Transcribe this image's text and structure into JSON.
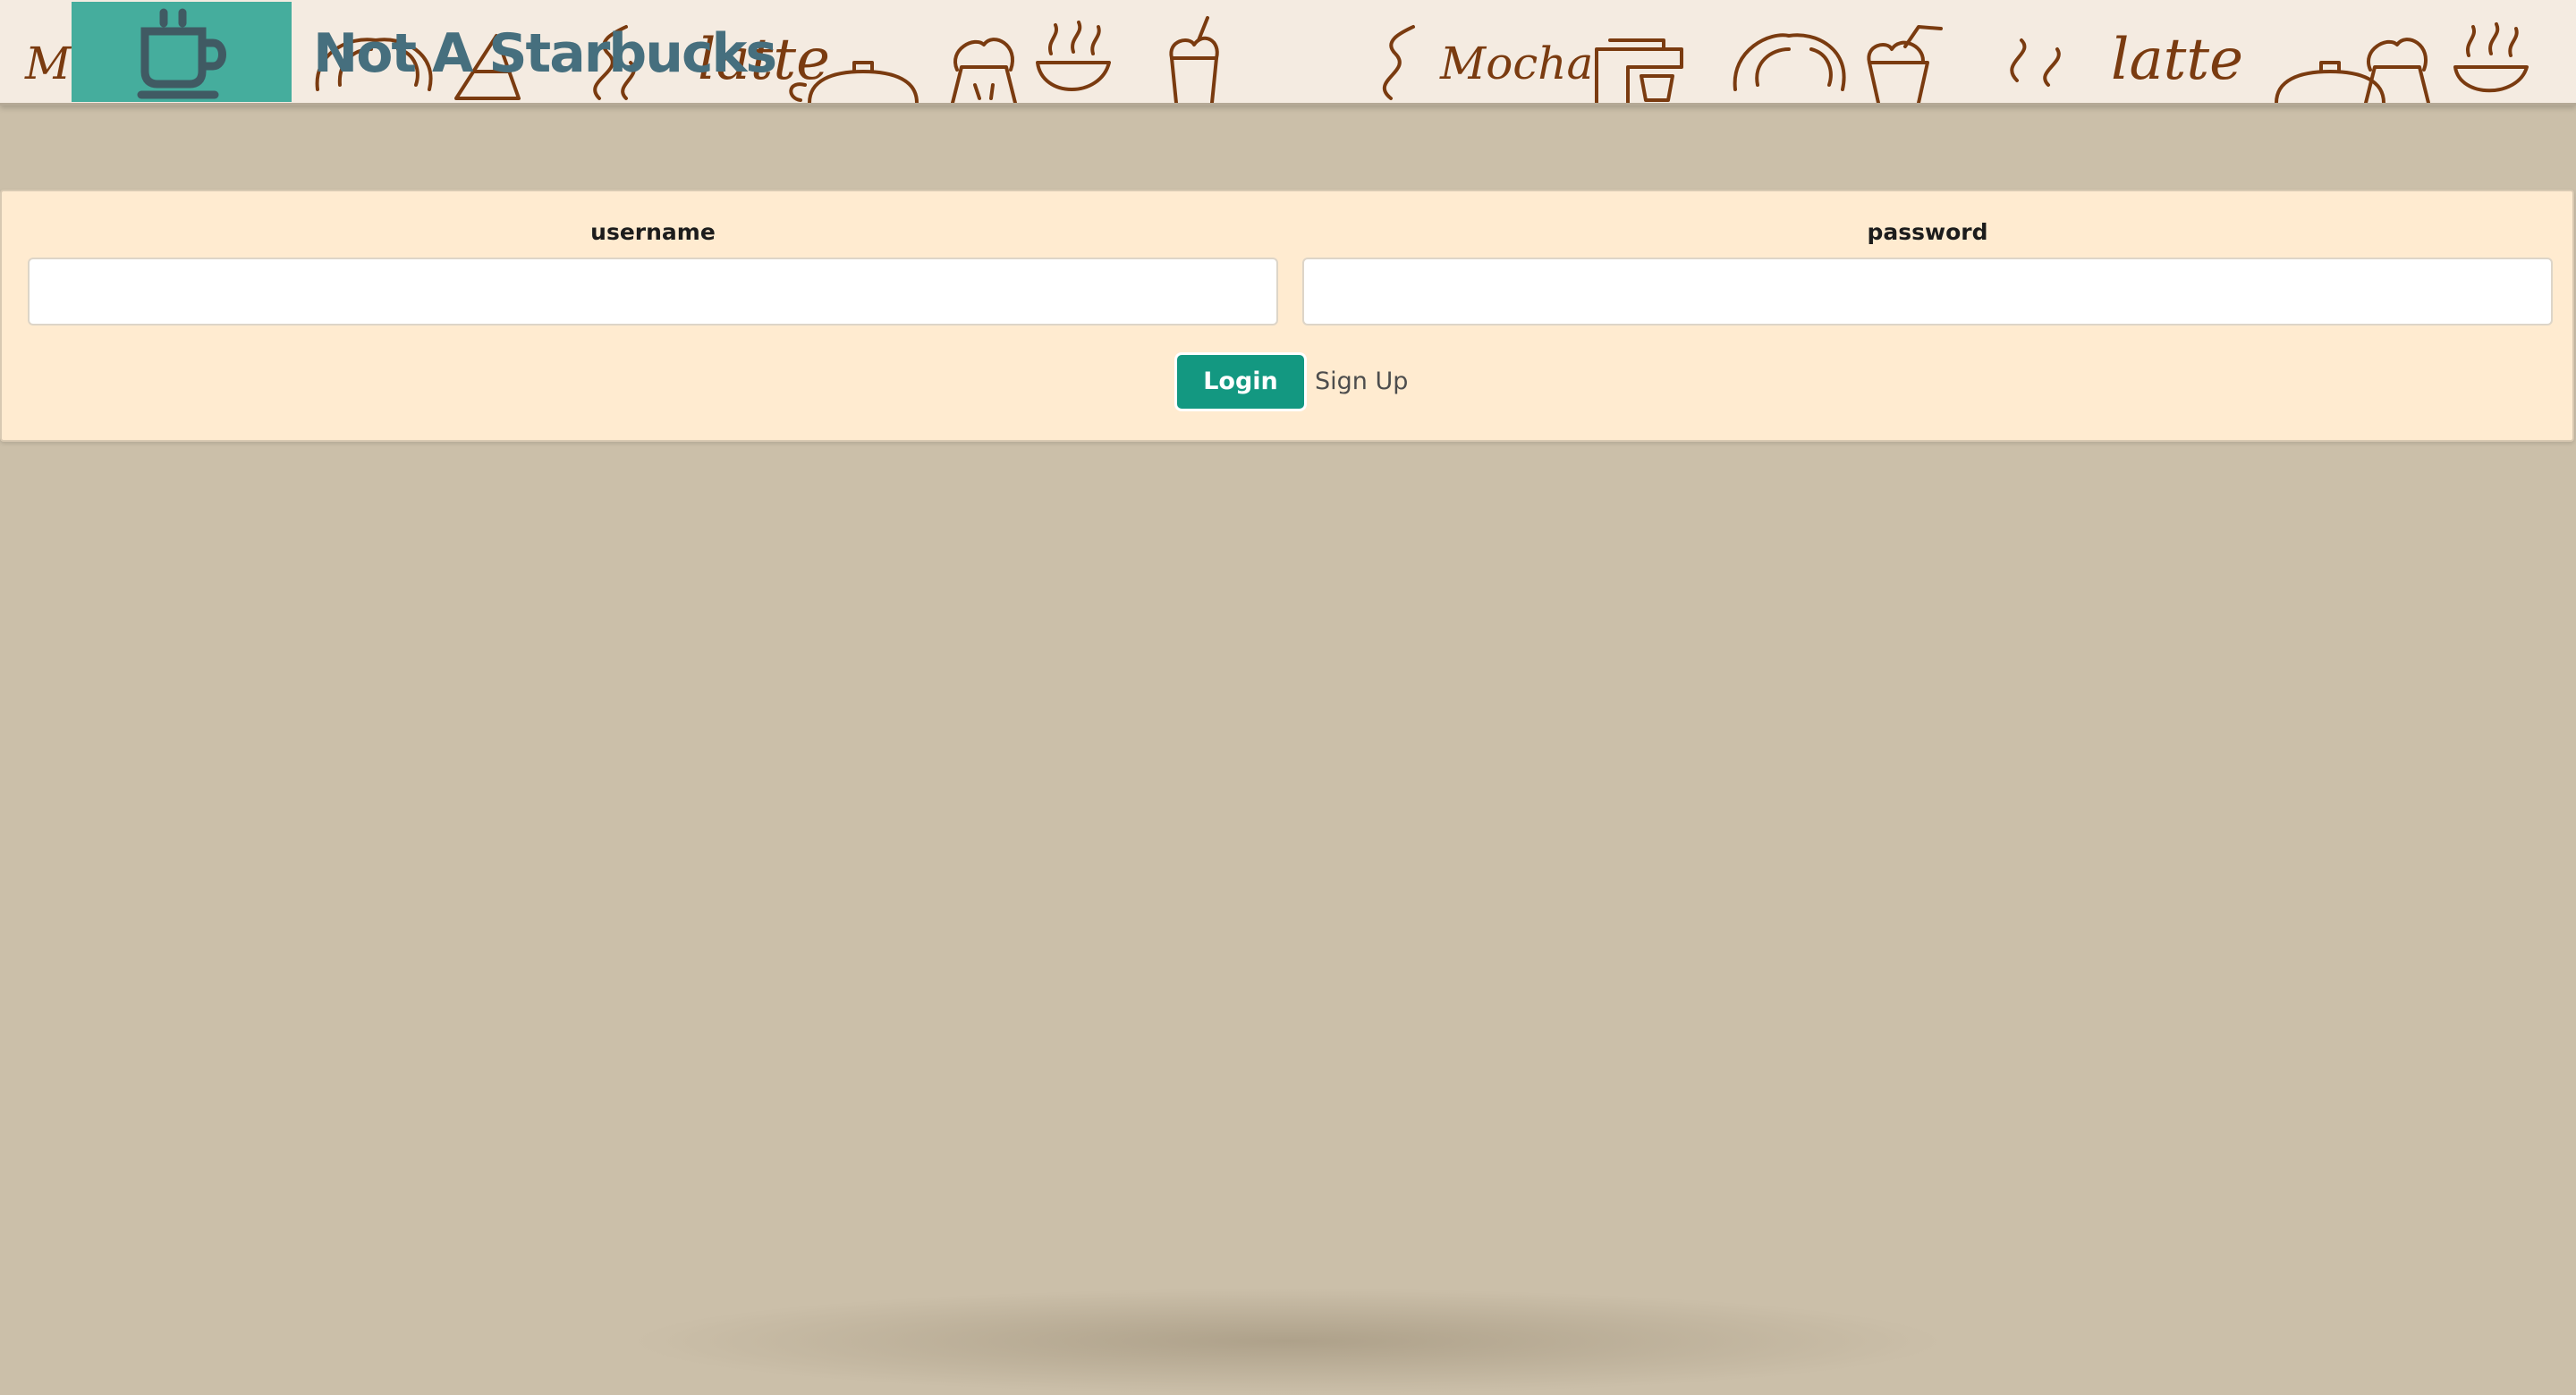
{
  "header": {
    "brand_name": "Not A Starbucks",
    "logo_icon": "coffee-cup-icon",
    "pattern_words": [
      "Mocha",
      "latte",
      "Mocha",
      "latte"
    ]
  },
  "login_form": {
    "username_label": "username",
    "username_value": "",
    "password_label": "password",
    "password_value": "",
    "login_label": "Login",
    "signup_label": "Sign Up"
  },
  "colors": {
    "page_background": "#cbbfa9",
    "header_background": "#f4ebe1",
    "doodle_brown": "#7a3b10",
    "logo_teal": "#45ad9d",
    "brand_slate": "#466f7e",
    "panel_background": "#ffebd0",
    "login_button": "#139881"
  }
}
